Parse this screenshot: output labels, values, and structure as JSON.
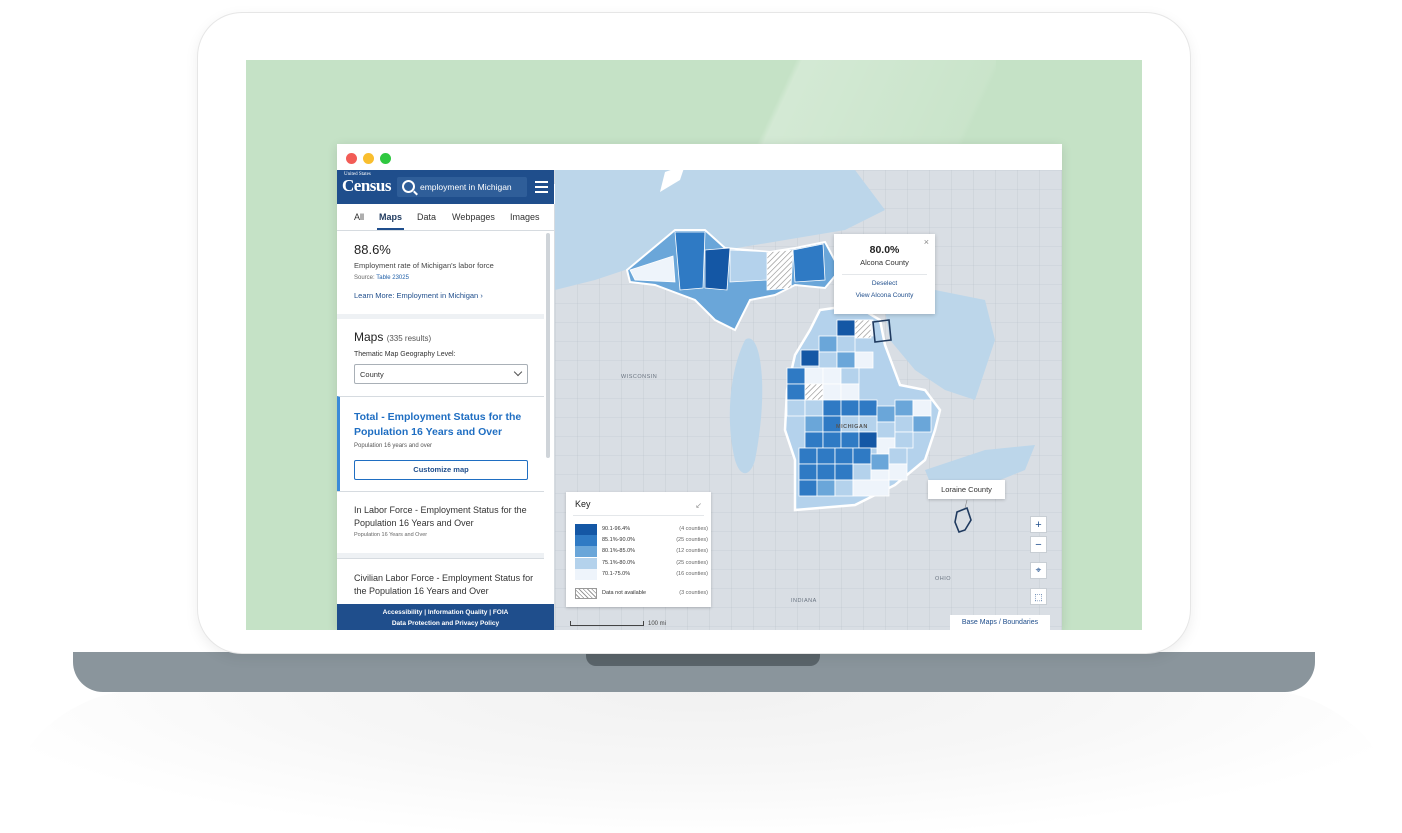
{
  "search": {
    "query": "employment in Michigan"
  },
  "logo": {
    "top": "United States",
    "main": "Census",
    "bottom": "Bureau"
  },
  "tabs": [
    {
      "label": "All"
    },
    {
      "label": "Maps"
    },
    {
      "label": "Data"
    },
    {
      "label": "Webpages"
    },
    {
      "label": "Images"
    }
  ],
  "stat": {
    "value": "88.6%",
    "description": "Employment rate of Michigan's labor force",
    "source_label": "Source:",
    "source_link": "Table 23025",
    "learn_more": "Learn More: Employment in Michigan"
  },
  "maps": {
    "heading": "Maps",
    "results": "(335 results)",
    "geo_label": "Thematic Map Geography Level:",
    "geo_value": "County"
  },
  "results": [
    {
      "title": "Total - Employment Status for the Population 16 Years and Over",
      "sub": "Population 16 years and over",
      "button": "Customize map"
    },
    {
      "title": "In Labor Force - Employment Status for the Population 16 Years and Over",
      "sub": "Population 16 Years and Over"
    },
    {
      "title": "Civilian Labor Force - Employment Status for the Population 16 Years and Over"
    }
  ],
  "footer": {
    "line1": "Accessibility  |  Information Quality  |  FOIA",
    "line2": "Data Protection and Privacy Policy"
  },
  "popup": {
    "value": "80.0%",
    "county": "Alcona County",
    "deselect": "Deselect",
    "view": "View Alcona County"
  },
  "tooltip": "Loraine County",
  "key": {
    "title": "Key",
    "rows": [
      {
        "range": "90.1-96.4%",
        "count": "(4 counties)",
        "color": "#1457a5"
      },
      {
        "range": "85.1%-90.0%",
        "count": "(25 counties)",
        "color": "#2f7ac4"
      },
      {
        "range": "80.1%-85.0%",
        "count": "(12 counties)",
        "color": "#6aa6d9"
      },
      {
        "range": "75.1%-80.0%",
        "count": "(25 counties)",
        "color": "#b4d2ec"
      },
      {
        "range": "70.1-75.0%",
        "count": "(16 counties)",
        "color": "#eef4fb"
      }
    ],
    "na_label": "Data not available",
    "na_count": "(3 counties)"
  },
  "map_labels": {
    "wisconsin": "WISCONSIN",
    "michigan": "MICHIGAN",
    "indiana": "INDIANA",
    "ohio": "OHIO"
  },
  "scale": "100 mi",
  "controls": {
    "zoom_in": "+",
    "zoom_out": "−",
    "collapse": "«"
  },
  "basemaps": "Base Maps / Boundaries"
}
